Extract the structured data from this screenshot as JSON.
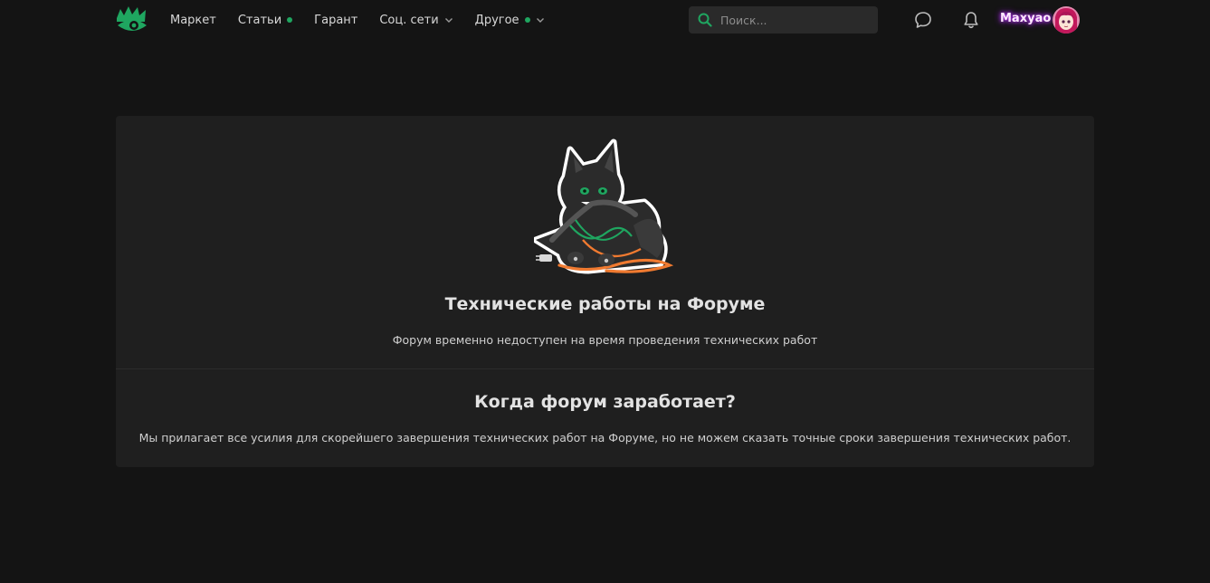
{
  "header": {
    "logo_icon": "eye-crown-logo-icon",
    "nav": [
      {
        "label": "Маркет",
        "dot": false,
        "dropdown": false
      },
      {
        "label": "Статьи",
        "dot": true,
        "dropdown": false
      },
      {
        "label": "Гарант",
        "dot": false,
        "dropdown": false
      },
      {
        "label": "Соц. сети",
        "dot": false,
        "dropdown": true
      },
      {
        "label": "Другое",
        "dot": true,
        "dropdown": true
      }
    ],
    "search": {
      "placeholder": "Поиск...",
      "value": ""
    },
    "user": {
      "name": "Maxyao"
    }
  },
  "maintenance": {
    "title": "Технические работы на Форуме",
    "description": "Форум временно недоступен на время проведения технических работ",
    "faq_title": "Когда форум заработает?",
    "faq_text": "Мы прилагает все усилия для скорейшего завершения технических работ на Форуме, но не можем сказать точные сроки завершения технических работ."
  },
  "colors": {
    "accent": "#1fa660",
    "background": "#141414",
    "panel": "#1f1f1f",
    "username_glow": "#c03cff"
  }
}
